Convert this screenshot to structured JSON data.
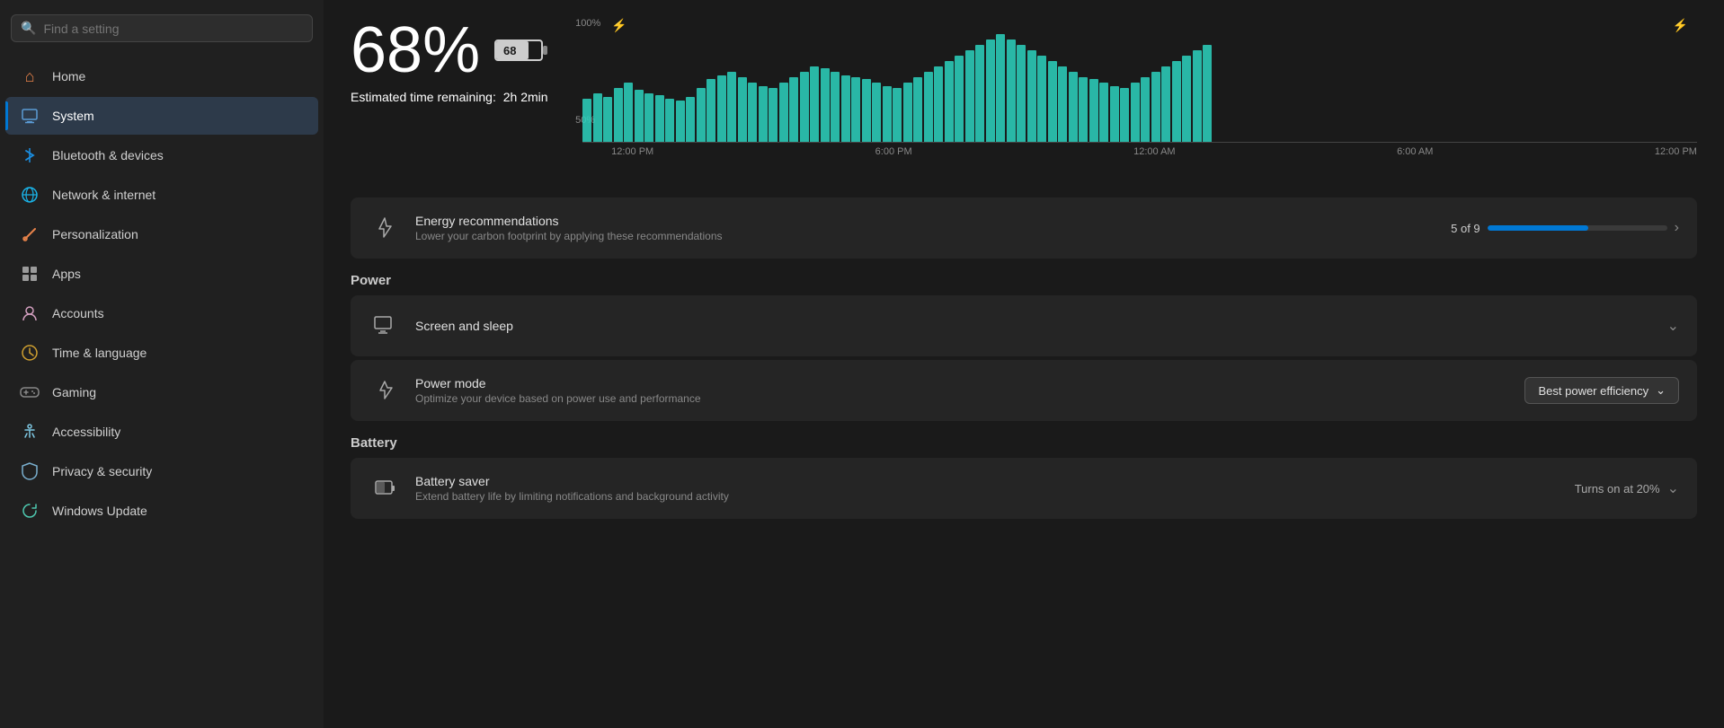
{
  "sidebar": {
    "search_placeholder": "Find a setting",
    "items": [
      {
        "id": "home",
        "label": "Home",
        "icon": "🏠",
        "icon_class": "home",
        "active": false
      },
      {
        "id": "system",
        "label": "System",
        "icon": "🖥",
        "icon_class": "system",
        "active": true
      },
      {
        "id": "bluetooth",
        "label": "Bluetooth & devices",
        "icon": "⬡",
        "icon_class": "bluetooth",
        "active": false
      },
      {
        "id": "network",
        "label": "Network & internet",
        "icon": "⊕",
        "icon_class": "network",
        "active": false
      },
      {
        "id": "personalization",
        "label": "Personalization",
        "icon": "✏",
        "icon_class": "personalization",
        "active": false
      },
      {
        "id": "apps",
        "label": "Apps",
        "icon": "⊞",
        "icon_class": "apps",
        "active": false
      },
      {
        "id": "accounts",
        "label": "Accounts",
        "icon": "👤",
        "icon_class": "accounts",
        "active": false
      },
      {
        "id": "time",
        "label": "Time & language",
        "icon": "🕐",
        "icon_class": "time",
        "active": false
      },
      {
        "id": "gaming",
        "label": "Gaming",
        "icon": "🎮",
        "icon_class": "gaming",
        "active": false
      },
      {
        "id": "accessibility",
        "label": "Accessibility",
        "icon": "♿",
        "icon_class": "accessibility",
        "active": false
      },
      {
        "id": "privacy",
        "label": "Privacy & security",
        "icon": "🛡",
        "icon_class": "privacy",
        "active": false
      },
      {
        "id": "update",
        "label": "Windows Update",
        "icon": "↻",
        "icon_class": "update",
        "active": false
      }
    ]
  },
  "battery": {
    "percent": "68%",
    "estimated_label": "Estimated time remaining:",
    "estimated_value": "2h 2min",
    "chart": {
      "y_labels": [
        "100%",
        "50%"
      ],
      "x_labels": [
        "12:00 PM",
        "6:00 PM",
        "12:00 AM",
        "6:00 AM",
        "12:00 PM"
      ],
      "charging_bolts": [
        true,
        false
      ],
      "bars": [
        40,
        45,
        42,
        50,
        55,
        48,
        45,
        43,
        40,
        38,
        42,
        50,
        58,
        62,
        65,
        60,
        55,
        52,
        50,
        55,
        60,
        65,
        70,
        68,
        65,
        62,
        60,
        58,
        55,
        52,
        50,
        55,
        60,
        65,
        70,
        75,
        80,
        85,
        90,
        95,
        100,
        95,
        90,
        85,
        80,
        75,
        70,
        65,
        60,
        58,
        55,
        52,
        50,
        55,
        60,
        65,
        70,
        75,
        80,
        85,
        90
      ]
    }
  },
  "energy_recommendations": {
    "title": "Energy recommendations",
    "subtitle": "Lower your carbon footprint by applying these recommendations",
    "progress_text": "5 of 9",
    "progress_percent": 56
  },
  "power_section": {
    "title": "Power",
    "screen_sleep": {
      "title": "Screen and sleep",
      "icon": "💻"
    },
    "power_mode": {
      "title": "Power mode",
      "subtitle": "Optimize your device based on power use and performance",
      "value": "Best power efficiency",
      "icon": "⚡"
    }
  },
  "battery_section": {
    "title": "Battery",
    "battery_saver": {
      "title": "Battery saver",
      "subtitle": "Extend battery life by limiting notifications and background activity",
      "value": "Turns on at 20%",
      "icon": "🔋"
    }
  }
}
